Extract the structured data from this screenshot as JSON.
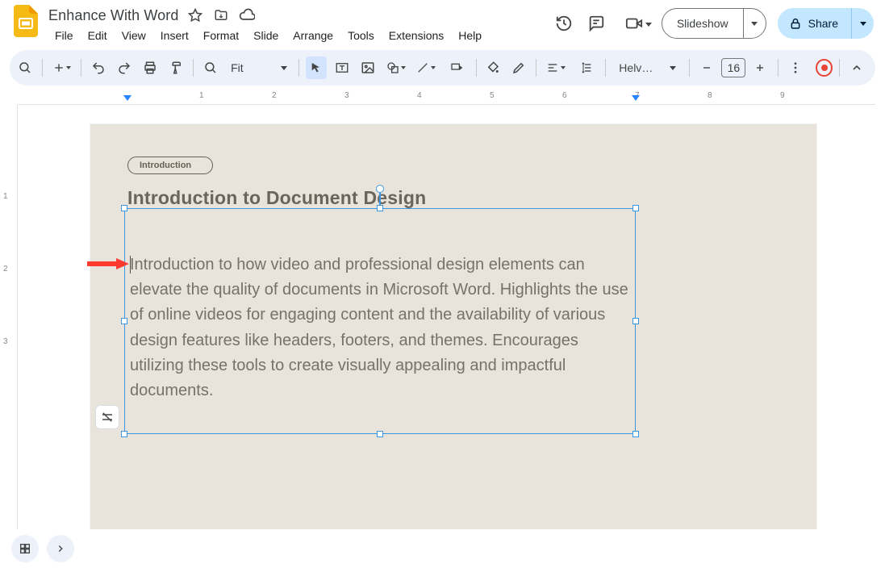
{
  "doc": {
    "title": "Enhance With Word"
  },
  "menu": {
    "items": [
      "File",
      "Edit",
      "View",
      "Insert",
      "Format",
      "Slide",
      "Arrange",
      "Tools",
      "Extensions",
      "Help"
    ]
  },
  "header_actions": {
    "slideshow": "Slideshow",
    "share": "Share"
  },
  "toolbar": {
    "zoom_label": "Fit",
    "font_name": "Helvet…",
    "font_size": "16"
  },
  "ruler_h": {
    "labels": [
      1,
      2,
      3,
      4,
      5,
      6,
      7,
      8,
      9
    ]
  },
  "ruler_v": {
    "labels": [
      1,
      2,
      3
    ]
  },
  "slide": {
    "pill": "Introduction",
    "title": "Introduction to Document Design",
    "body": "Introduction to how video and professional design elements can elevate the quality of documents in Microsoft Word. Highlights the use of online videos for engaging content and the availability of various design features like headers, footers, and themes. Encourages utilizing these tools to create visually appealing and impactful documents."
  }
}
